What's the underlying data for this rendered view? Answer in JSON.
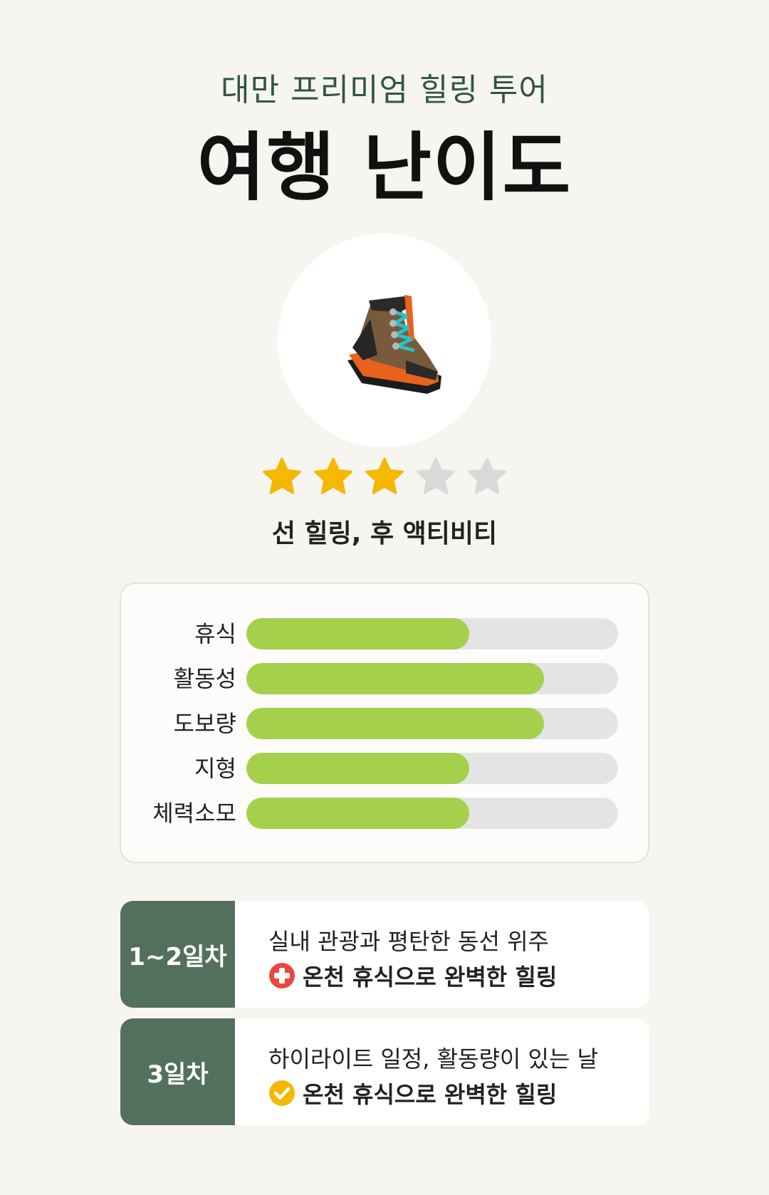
{
  "header": {
    "subtitle": "대만 프리미엄 힐링 투어",
    "title": "여행 난이도"
  },
  "hero": {
    "icon": "hiking-boot-icon"
  },
  "rating": {
    "value": 3,
    "max": 5,
    "filled_color": "#f5b800",
    "empty_color": "#d9d9d9"
  },
  "tagline": "선 힐링, 후 액티비티",
  "meters": [
    {
      "label": "휴식",
      "level": 0.6
    },
    {
      "label": "활동성",
      "level": 0.8
    },
    {
      "label": "도보량",
      "level": 0.8
    },
    {
      "label": "지형",
      "level": 0.6
    },
    {
      "label": "체력소모",
      "level": 0.6
    }
  ],
  "days": [
    {
      "badge": "1~2일차",
      "line1": "실내 관광과 평탄한 동선 위주",
      "line2": "온천 휴식으로 완벽한 힐링",
      "icon": "red-cross-icon"
    },
    {
      "badge": "3일차",
      "line1": "하이라이트 일정, 활동량이 있는 날",
      "line2": "온천 휴식으로 완벽한 힐링",
      "icon": "check-circle-icon"
    }
  ],
  "colors": {
    "background": "#f7f5ef",
    "accent_green": "#2f5641",
    "badge_green": "#53705d",
    "meter_fill": "#a5d04b",
    "meter_track": "#e4e4e4"
  }
}
